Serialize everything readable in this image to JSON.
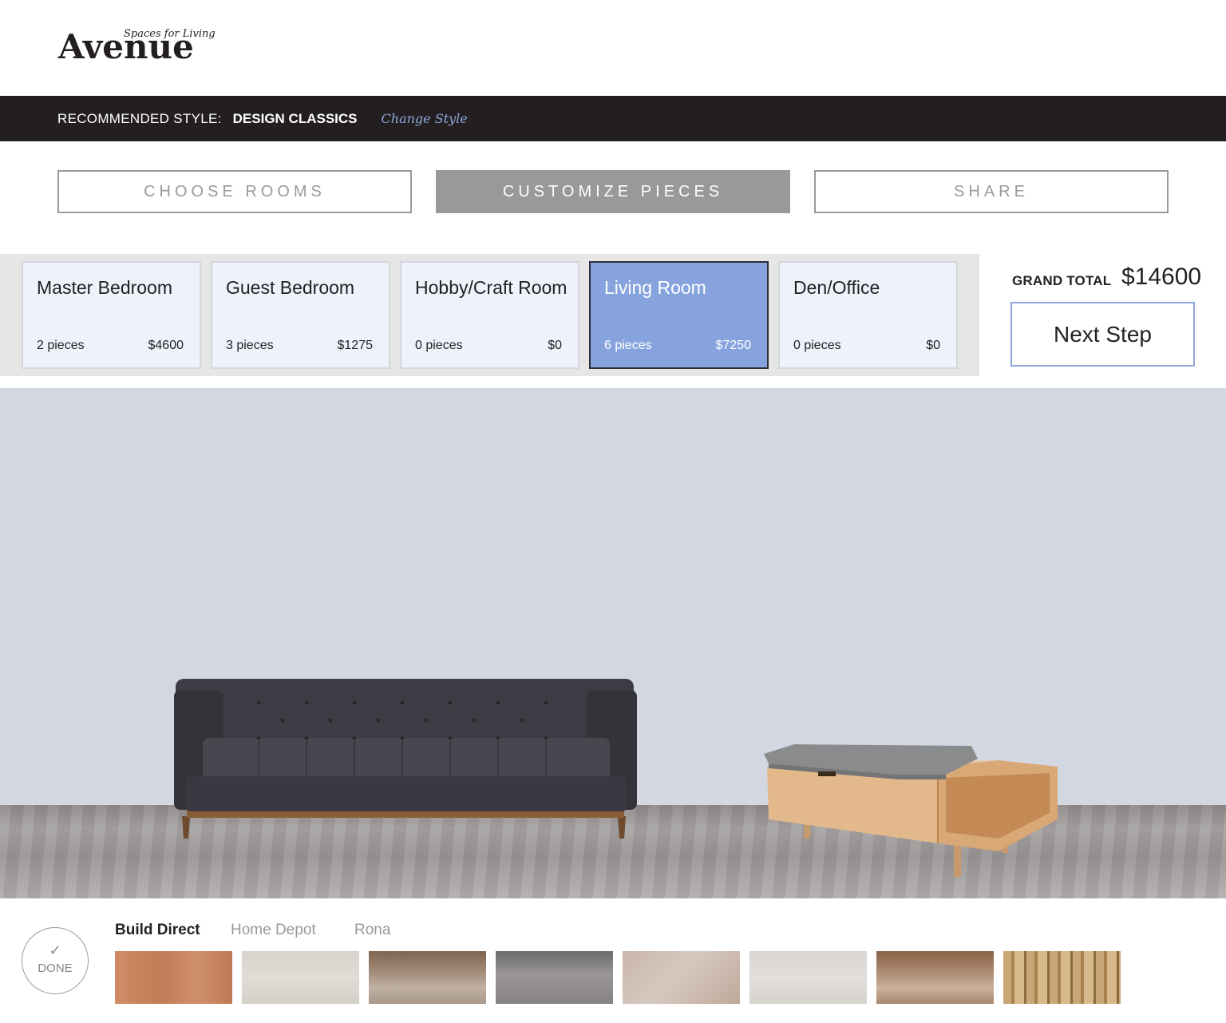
{
  "brand": {
    "tagline": "Spaces for Living",
    "name": "Avenue"
  },
  "style_bar": {
    "label": "RECOMMENDED STYLE:",
    "value": "DESIGN CLASSICS",
    "change_link": "Change Style"
  },
  "steps": [
    {
      "label": "CHOOSE ROOMS",
      "active": false
    },
    {
      "label": "CUSTOMIZE PIECES",
      "active": true
    },
    {
      "label": "SHARE",
      "active": false
    }
  ],
  "rooms": [
    {
      "name": "Master Bedroom",
      "pieces": "2 pieces",
      "price": "$4600",
      "active": false
    },
    {
      "name": "Guest Bedroom",
      "pieces": "3 pieces",
      "price": "$1275",
      "active": false
    },
    {
      "name": "Hobby/Craft Room",
      "pieces": "0 pieces",
      "price": "$0",
      "active": false
    },
    {
      "name": "Living Room",
      "pieces": "6 pieces",
      "price": "$7250",
      "active": true
    },
    {
      "name": "Den/Office",
      "pieces": "0 pieces",
      "price": "$0",
      "active": false
    }
  ],
  "grand_total": {
    "label": "GRAND TOTAL",
    "value": "$14600"
  },
  "next_step": "Next Step",
  "done": {
    "label": "DONE",
    "icon": "check-icon"
  },
  "vendors": [
    {
      "label": "Build Direct",
      "active": true
    },
    {
      "label": "Home Depot",
      "active": false
    },
    {
      "label": "Rona",
      "active": false
    }
  ],
  "colors": {
    "accent": "#87a3dd",
    "dark_bar": "#231f20",
    "scene_wall": "#d3d7e2",
    "link": "#8fa6db"
  },
  "swatches": [
    {
      "name": "light-cherry-wood",
      "color": "#c88662"
    },
    {
      "name": "white-carpet",
      "color": "#dcd8d2"
    },
    {
      "name": "medium-oak-wood",
      "color": "#a48e7c"
    },
    {
      "name": "grey-concrete",
      "color": "#8f8c8e"
    },
    {
      "name": "beige-marble",
      "color": "#cbbab0"
    },
    {
      "name": "off-white-carpet",
      "color": "#dedbd6"
    },
    {
      "name": "warm-oak-wood",
      "color": "#a8826a"
    },
    {
      "name": "distressed-pine",
      "color": "#b89a6c"
    }
  ]
}
